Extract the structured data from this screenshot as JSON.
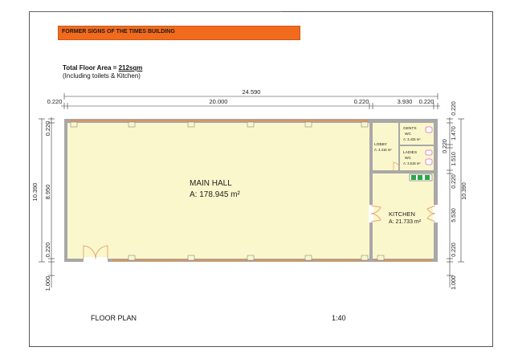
{
  "banner": {
    "title": "FORMER SIGNS OF THE TIMES BUILDING",
    "color": "#f26b1d"
  },
  "summary": {
    "total_label": "Total Floor Area = ",
    "total_value": "212sqm",
    "note": "(Including toilets & Kitchen)"
  },
  "dimensions": {
    "top_overall": "24.590",
    "top_wall_left": "0.220",
    "top_main": "20.000",
    "top_wall_mid": "0.220",
    "top_side": "3.930",
    "top_wall_right": "0.220",
    "left_overall": "10.390",
    "left_top_wall": "0.220",
    "left_mid": "8.950",
    "left_bottom_wall": "0.220",
    "left_bottom": "1.000",
    "right_top_wall": "0.220",
    "right_1": "1.470",
    "right_wall_2": "0.220",
    "right_2": "1.510",
    "right_wall_3": "0.220",
    "right_3": "5.530",
    "right_overall": "10.390",
    "right_bottom_wall": "0.220",
    "right_bottom": "1.000"
  },
  "rooms": {
    "main_hall": {
      "name": "MAIN HALL",
      "area": "A: 178.945 m²"
    },
    "kitchen": {
      "name": "KITCHEN",
      "area": "A: 21.733 m²"
    },
    "gents": {
      "name": "GENTS",
      "sub": "WC",
      "area": "A: 3.425 m²"
    },
    "ladies": {
      "name": "LADIES",
      "sub": "WC",
      "area": "A: 3.518 m²"
    },
    "lobby": {
      "name": "LOBBY",
      "area": "A: 4.416 m²"
    }
  },
  "footer": {
    "title": "FLOOR PLAN",
    "scale": "1:40"
  },
  "colors": {
    "floor": "#fbf7cc",
    "wall": "#a8a8a8",
    "window": "#ef8a3a",
    "door": "#e7a77a",
    "fixture": "#d86bc1",
    "counter": "#2aa84a"
  }
}
